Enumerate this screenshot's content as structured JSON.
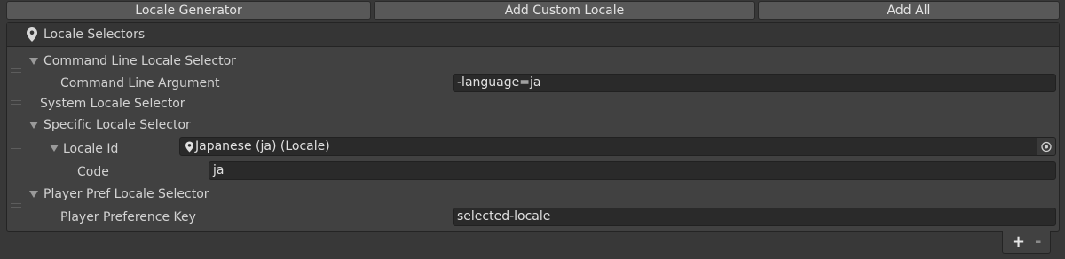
{
  "toolbar": {
    "locale_generator": "Locale Generator",
    "add_custom_locale": "Add Custom Locale",
    "add_all": "Add All"
  },
  "panel": {
    "title": "Locale Selectors",
    "command_line": {
      "title": "Command Line Locale Selector",
      "arg_label": "Command Line Argument",
      "arg_value": "-language=ja"
    },
    "system": {
      "title": "System Locale Selector"
    },
    "specific": {
      "title": "Specific Locale Selector",
      "locale_id_label": "Locale Id",
      "locale_id_value": "Japanese (ja) (Locale)",
      "code_label": "Code",
      "code_value": "ja"
    },
    "player_pref": {
      "title": "Player Pref Locale Selector",
      "key_label": "Player Preference Key",
      "key_value": "selected-locale"
    }
  },
  "list_footer": {
    "add": "+",
    "remove": "-"
  },
  "icons": {
    "header_icon": "map-pin-icon",
    "locale_icon": "map-pin-icon",
    "picker_icon": "object-picker-icon",
    "reorder_handle": "drag-handle-icon",
    "foldout": "foldout-arrow-icon"
  },
  "colors": {
    "background": "#383838",
    "panel": "#414141",
    "button": "#585858",
    "field": "#2a2a2a",
    "text": "#d2d2d2"
  }
}
